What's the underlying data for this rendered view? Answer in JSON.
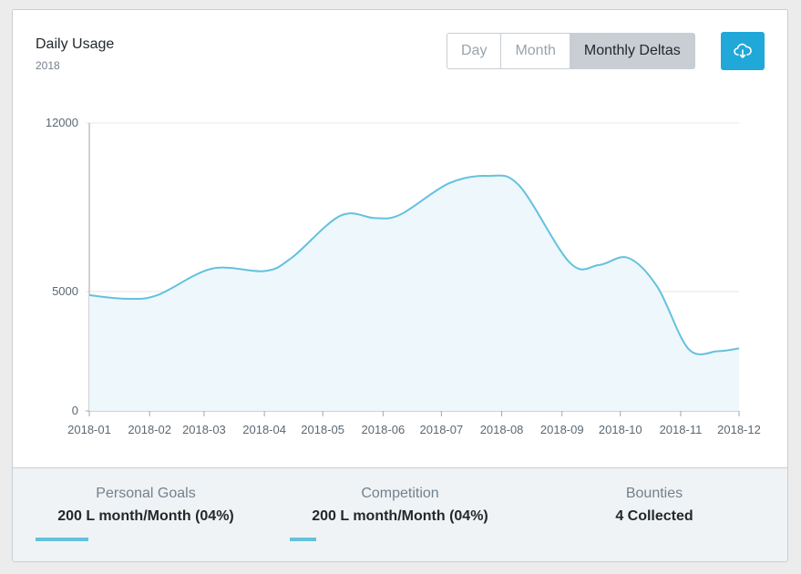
{
  "card": {
    "title": "Daily Usage",
    "subtitle": "2018"
  },
  "toolbar": {
    "options": [
      "Day",
      "Month",
      "Monthly Deltas"
    ],
    "active": "Monthly Deltas",
    "download_icon": "cloud-download-icon"
  },
  "colors": {
    "accent": "#20a8d8",
    "line": "#63c2de",
    "area": "#eef7fb"
  },
  "chart_data": {
    "type": "area",
    "x": [
      "2018-01",
      "2018-02",
      "2018-03",
      "2018-04",
      "2018-05",
      "2018-06",
      "2018-07",
      "2018-08",
      "2018-09",
      "2018-10",
      "2018-11",
      "2018-12"
    ],
    "series": [
      {
        "values": [
          [
            "2018-01-01",
            4850
          ],
          [
            "2018-01-20",
            4700
          ],
          [
            "2018-02-05",
            4850
          ],
          [
            "2018-03-05",
            5950
          ],
          [
            "2018-04-01",
            5850
          ],
          [
            "2018-04-15",
            6400
          ],
          [
            "2018-05-10",
            8150
          ],
          [
            "2018-05-28",
            8050
          ],
          [
            "2018-06-10",
            8200
          ],
          [
            "2018-07-05",
            9500
          ],
          [
            "2018-07-25",
            9800
          ],
          [
            "2018-08-10",
            9400
          ],
          [
            "2018-09-05",
            6200
          ],
          [
            "2018-09-20",
            6100
          ],
          [
            "2018-10-05",
            6400
          ],
          [
            "2018-10-20",
            5200
          ],
          [
            "2018-11-05",
            2600
          ],
          [
            "2018-11-20",
            2500
          ],
          [
            "2018-12-01",
            2620
          ]
        ]
      }
    ],
    "yticks": [
      0,
      5000,
      12000
    ],
    "ylim": [
      0,
      12000
    ],
    "grid": true
  },
  "footer": {
    "stats": [
      {
        "label": "Personal Goals",
        "value": "200 L month/Month (04%)",
        "progress": 0.24
      },
      {
        "label": "Competition",
        "value": "200 L month/Month (04%)",
        "progress": 0.12
      },
      {
        "label": "Bounties",
        "value": "4 Collected"
      }
    ]
  }
}
